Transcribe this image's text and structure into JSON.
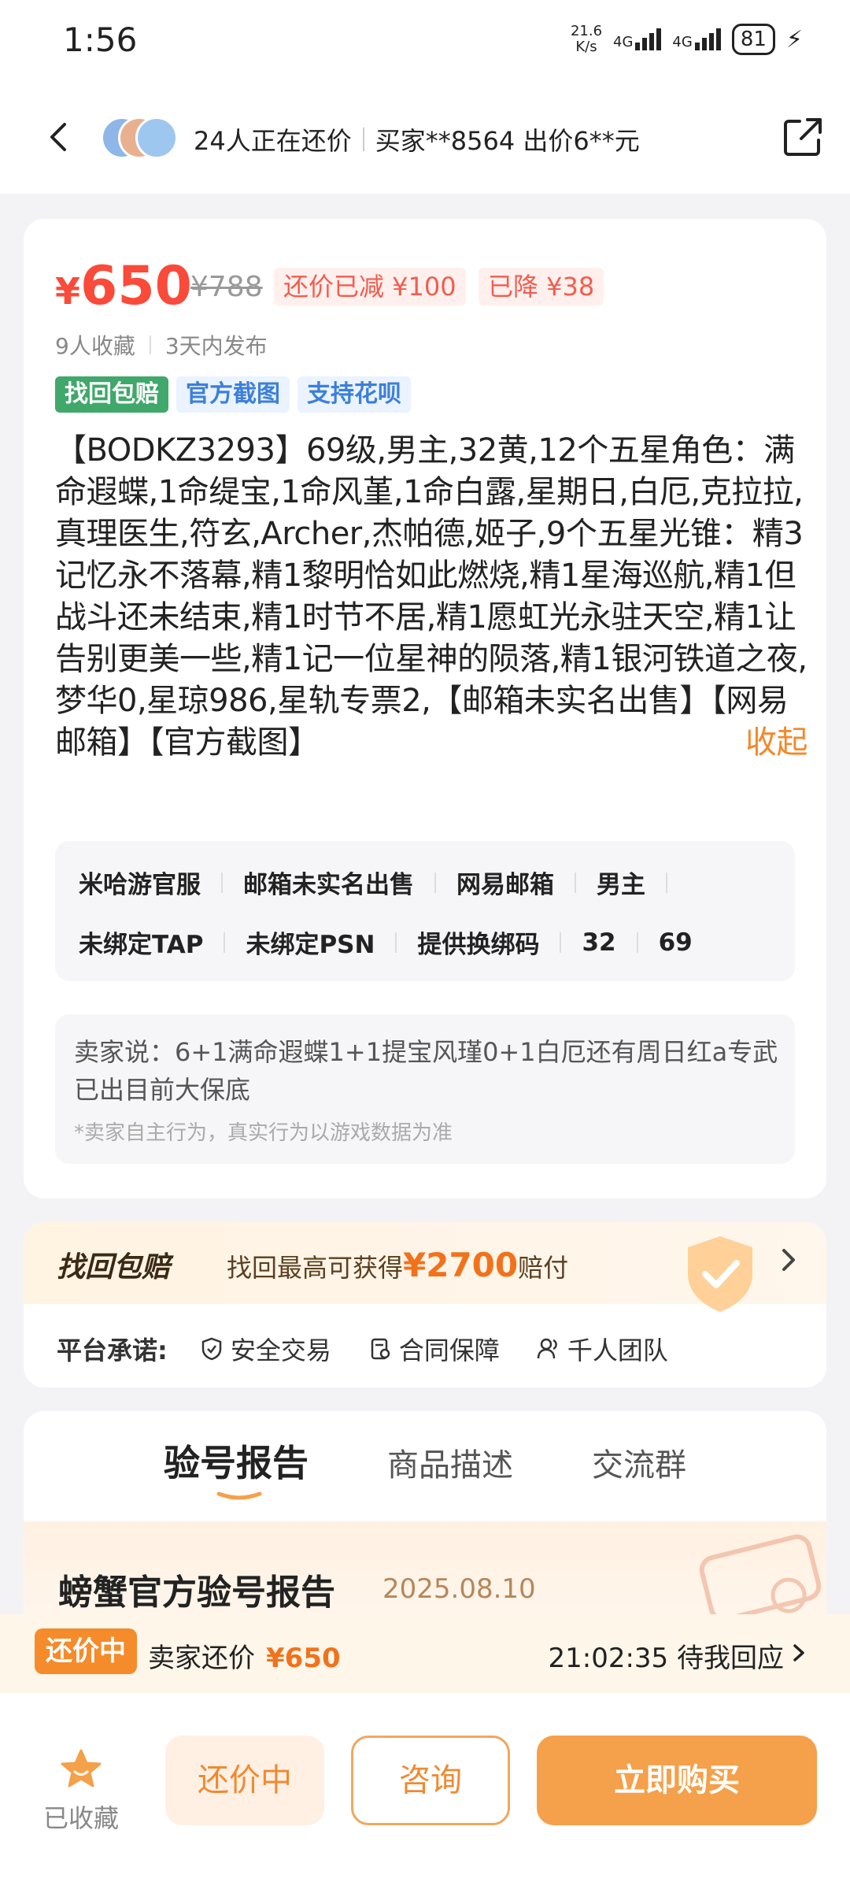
{
  "status_bar": {
    "time": "1:56",
    "net_speed_value": "21.6",
    "net_speed_unit": "K/s",
    "sig1": "4G",
    "sig2": "4G",
    "battery": "81"
  },
  "header": {
    "bargain_count_text": "24人正在还价",
    "latest_offer_text": "买家**8564 出价6**元"
  },
  "product": {
    "price_symbol": "¥",
    "price": "650",
    "original_price": "¥788",
    "counter_reduced": "还价已减 ¥100",
    "price_drop": "已降 ¥38",
    "favorites": "9人收藏",
    "published": "3天内发布",
    "tags": [
      "找回包赔",
      "官方截图",
      "支持花呗"
    ],
    "description": "【BODKZ3293】69级,男主,32黄,12个五星角色：满命遐蝶,1命缇宝,1命风堇,1命白露,星期日,白厄,克拉拉,真理医生,符玄,Archer,杰帕德,姬子,9个五星光锥：精3记忆永不落幕,精1黎明恰如此燃烧,精1星海巡航,精1但战斗还未结束,精1时节不居,精1愿虹光永驻天空,精1让告别更美一些,精1记一位星神的陨落,精1银河铁道之夜,梦华0,星琼986,星轨专票2,【邮箱未实名出售】【网易邮箱】【官方截图】",
    "collapse_label": "收起",
    "attributes_row1": [
      "米哈游官服",
      "邮箱未实名出售",
      "网易邮箱",
      "男主"
    ],
    "attributes_row2": [
      "未绑定TAP",
      "未绑定PSN",
      "提供换绑码",
      "32",
      "69"
    ],
    "seller_says": "卖家说：6+1满命遐蝶1+1提宝风瑾0+1白厄还有周日红a专武已出目前大保底",
    "seller_note": "*卖家自主行为，真实行为以游戏数据为准"
  },
  "guarantee": {
    "title": "找回包赔",
    "text_prefix": "找回最高可获得",
    "amount": "¥2700",
    "text_suffix": "赔付",
    "promise_label": "平台承诺:",
    "promises": [
      "安全交易",
      "合同保障",
      "千人团队"
    ]
  },
  "tabs": [
    "验号报告",
    "商品描述",
    "交流群"
  ],
  "report": {
    "title": "螃蟹官方验号报告",
    "date": "2025.08.10"
  },
  "counter_bar": {
    "badge": "还价中",
    "label": "卖家还价",
    "price": "¥650",
    "countdown": "21:02:35 待我回应"
  },
  "bottom_bar": {
    "favorite_label": "已收藏",
    "counter_button": "还价中",
    "consult_button": "咨询",
    "buy_button": "立即购买"
  },
  "colors": {
    "price_red": "#fa4a3a",
    "accent_orange": "#f5a04a",
    "tag_green": "#3fa86a",
    "tag_blue": "#3c7fd9"
  }
}
